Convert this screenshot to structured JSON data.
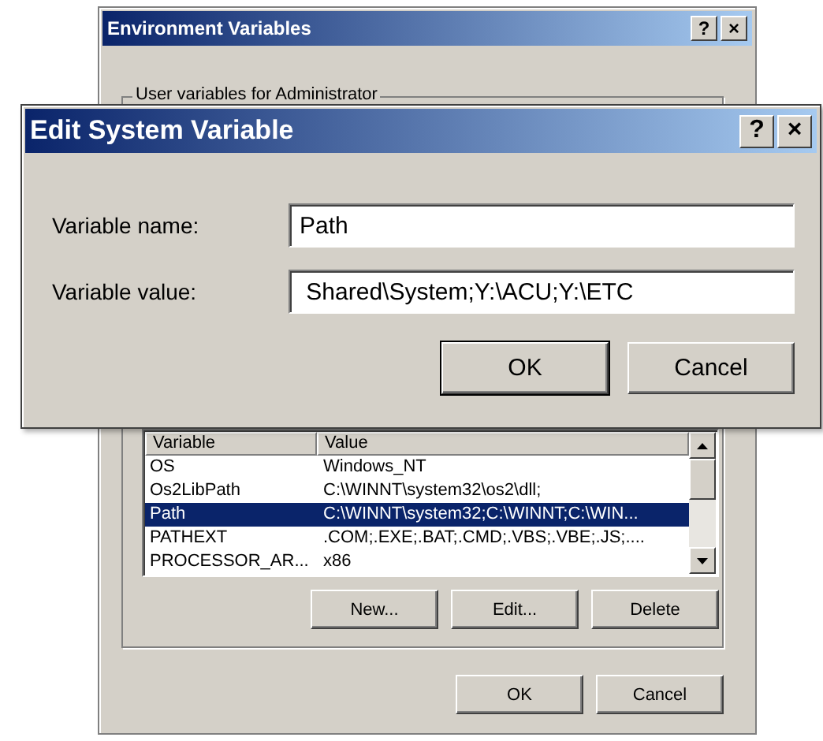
{
  "background_window": {
    "title": "Environment Variables",
    "help_button": "?",
    "close_button": "×",
    "group_label": "User variables for Administrator",
    "columns": [
      "Variable",
      "Value"
    ],
    "rows": [
      {
        "variable": "OS",
        "value": "Windows_NT",
        "selected": false
      },
      {
        "variable": "Os2LibPath",
        "value": "C:\\WINNT\\system32\\os2\\dll;",
        "selected": false
      },
      {
        "variable": "Path",
        "value": "C:\\WINNT\\system32;C:\\WINNT;C:\\WIN...",
        "selected": true
      },
      {
        "variable": "PATHEXT",
        "value": ".COM;.EXE;.BAT;.CMD;.VBS;.VBE;.JS;....",
        "selected": false
      },
      {
        "variable": "PROCESSOR_AR...",
        "value": "x86",
        "selected": false
      }
    ],
    "list_buttons": [
      "New...",
      "Edit...",
      "Delete"
    ],
    "buttons": [
      "OK",
      "Cancel"
    ]
  },
  "dialog": {
    "title": "Edit System Variable",
    "help_button": "?",
    "close_button": "×",
    "fields": [
      {
        "label": "Variable name:",
        "value": "Path"
      },
      {
        "label": "Variable value:",
        "value": " Shared\\System;Y:\\ACU;Y:\\ETC"
      }
    ],
    "buttons": [
      {
        "label": "OK",
        "default": true
      },
      {
        "label": "Cancel",
        "default": false
      }
    ]
  }
}
